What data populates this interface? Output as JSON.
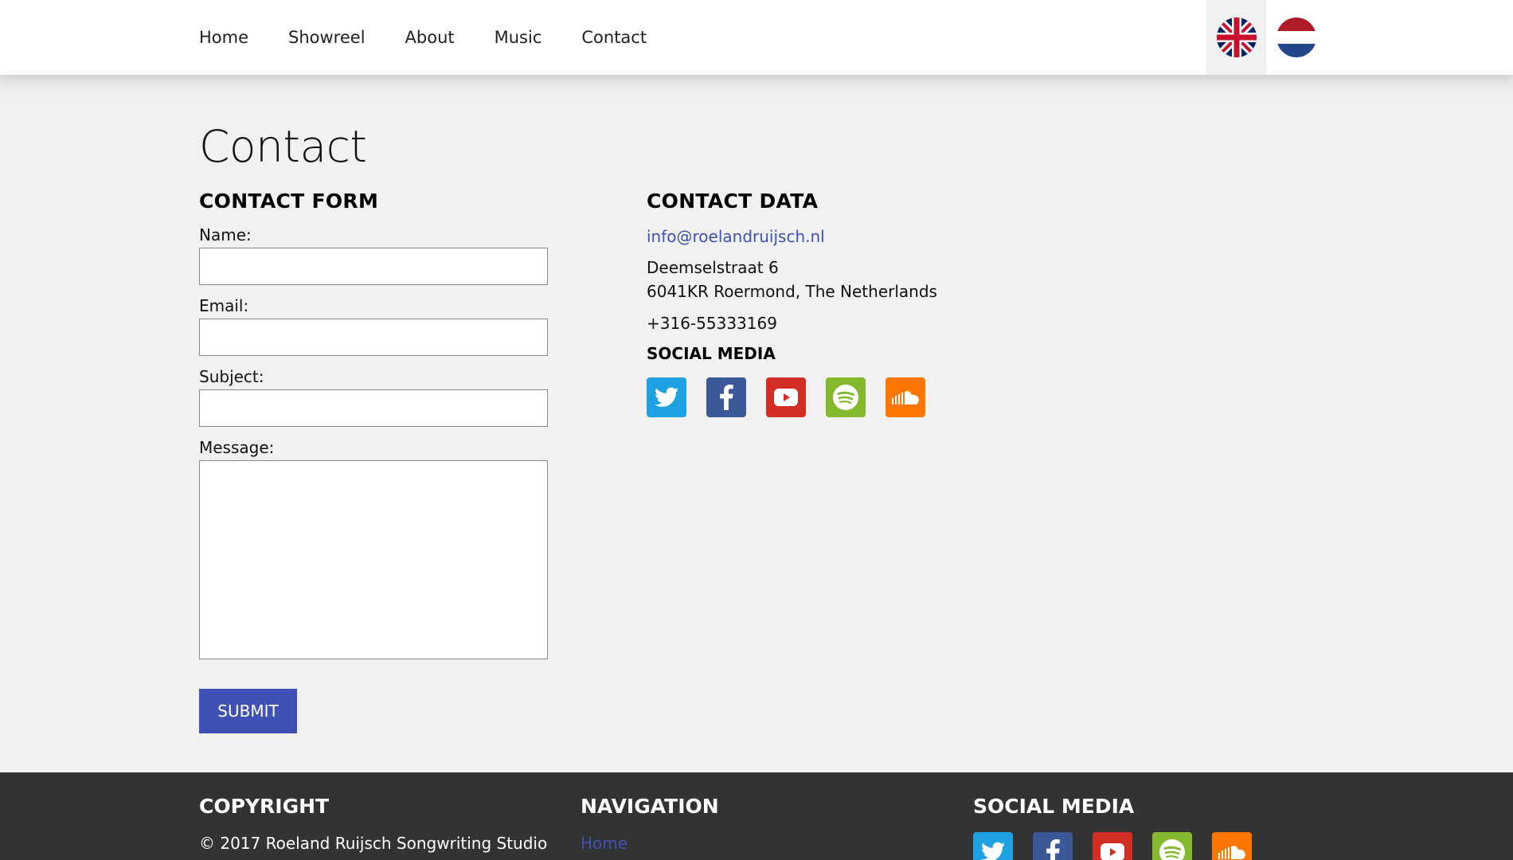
{
  "nav": {
    "items": [
      {
        "label": "Home"
      },
      {
        "label": "Showreel"
      },
      {
        "label": "About"
      },
      {
        "label": "Music"
      },
      {
        "label": "Contact"
      }
    ],
    "languages": [
      {
        "icon": "uk-flag-icon",
        "active": true
      },
      {
        "icon": "netherlands-flag-icon",
        "active": false
      }
    ]
  },
  "page": {
    "title": "Contact"
  },
  "form": {
    "heading": "CONTACT FORM",
    "name_label": "Name:",
    "email_label": "Email:",
    "subject_label": "Subject:",
    "message_label": "Message:",
    "name_value": "",
    "email_value": "",
    "subject_value": "",
    "message_value": "",
    "submit_label": "SUBMIT"
  },
  "contact": {
    "heading": "CONTACT DATA",
    "email": "info@roelandruijsch.nl",
    "address_line1": "Deemselstraat 6",
    "address_line2": "6041KR Roermond, The Netherlands",
    "phone": "+316-55333169",
    "social_heading": "SOCIAL MEDIA"
  },
  "social": [
    {
      "icon": "twitter-icon",
      "color": "#1da1e2"
    },
    {
      "icon": "facebook-icon",
      "color": "#3b5998"
    },
    {
      "icon": "youtube-icon",
      "color": "#d32e26"
    },
    {
      "icon": "spotify-icon",
      "color": "#84b82d"
    },
    {
      "icon": "soundcloud-icon",
      "color": "#ff7700"
    }
  ],
  "footer": {
    "copyright_heading": "COPYRIGHT",
    "copyright_text": "© 2017 Roeland Ruijsch Songwriting Studio",
    "nav_heading": "NAVIGATION",
    "nav_first": "Home",
    "social_heading": "SOCIAL MEDIA"
  },
  "colors": {
    "accent": "#3f51b5",
    "page_bg": "#f1f1f1",
    "footer_bg": "#333333"
  }
}
